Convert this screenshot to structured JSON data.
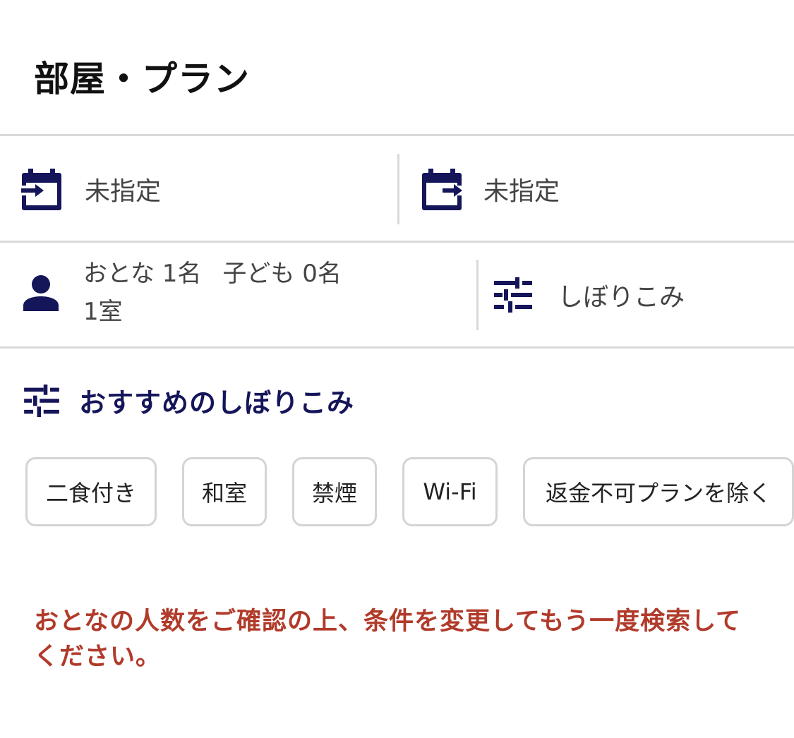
{
  "header": {
    "title": "部屋・プラン"
  },
  "dates": {
    "checkin_label": "未指定",
    "checkout_label": "未指定"
  },
  "guests": {
    "adults": "おとな 1名",
    "children": "子ども 0名",
    "rooms": "1室"
  },
  "filter": {
    "label": "しぼりこみ"
  },
  "recommend": {
    "title": "おすすめのしぼりこみ",
    "chips": [
      "二食付き",
      "和室",
      "禁煙",
      "Wi-Fi",
      "返金不可プランを除く"
    ]
  },
  "error_message": "おとなの人数をご確認の上、条件を変更してもう一度検索してください。",
  "colors": {
    "accent": "#15155a",
    "error": "#b13a2a",
    "divider": "#d9d9d9"
  },
  "icons": {
    "checkin": "calendar-checkin-icon",
    "checkout": "calendar-checkout-icon",
    "person": "person-icon",
    "tune": "tune-icon"
  }
}
